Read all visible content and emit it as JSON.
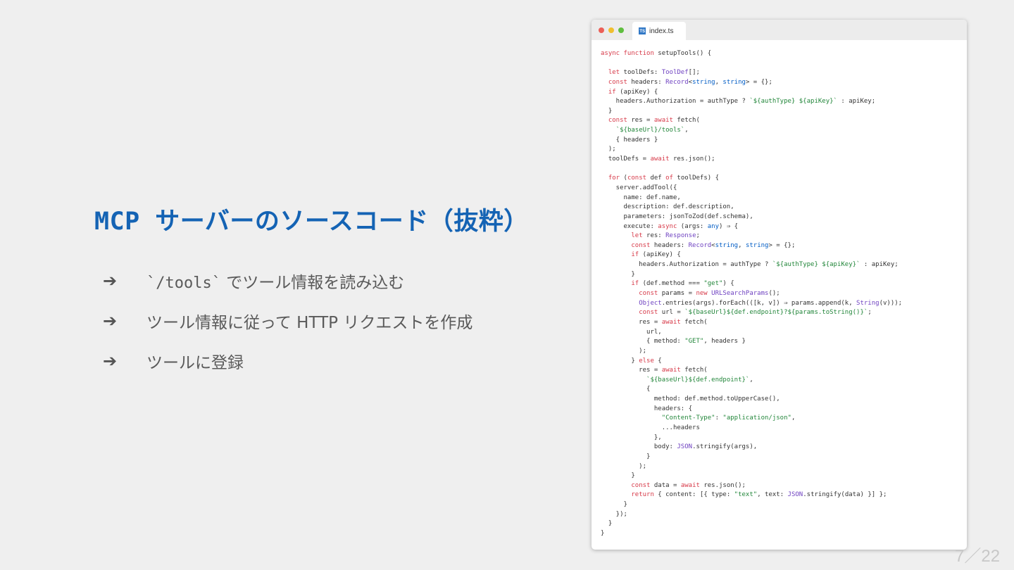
{
  "slide": {
    "title": "MCP サーバーのソースコード（抜粋）",
    "bullets": [
      {
        "arrow": "➔",
        "code": "`/tools`",
        "text": " でツール情報を読み込む"
      },
      {
        "arrow": "➔",
        "code": "",
        "text": "ツール情報に従って HTTP リクエストを作成"
      },
      {
        "arrow": "➔",
        "code": "",
        "text": "ツールに登録"
      }
    ],
    "page_number": "7／22"
  },
  "editor": {
    "tab_name": "index.ts",
    "tab_icon": "typescript-icon",
    "code_lines": [
      "async function setupTools() {",
      "",
      "  let toolDefs: ToolDef[];",
      "  const headers: Record<string, string> = {};",
      "  if (apiKey) {",
      "    headers.Authorization = authType ? `${authType} ${apiKey}` : apiKey;",
      "  }",
      "  const res = await fetch(",
      "    `${baseUrl}/tools`,",
      "    { headers }",
      "  );",
      "  toolDefs = await res.json();",
      "",
      "  for (const def of toolDefs) {",
      "    server.addTool({",
      "      name: def.name,",
      "      description: def.description,",
      "      parameters: jsonToZod(def.schema),",
      "      execute: async (args: any) ⇒ {",
      "        let res: Response;",
      "        const headers: Record<string, string> = {};",
      "        if (apiKey) {",
      "          headers.Authorization = authType ? `${authType} ${apiKey}` : apiKey;",
      "        }",
      "        if (def.method === \"get\") {",
      "          const params = new URLSearchParams();",
      "          Object.entries(args).forEach(([k, v]) ⇒ params.append(k, String(v)));",
      "          const url = `${baseUrl}${def.endpoint}?${params.toString()}`;",
      "          res = await fetch(",
      "            url,",
      "            { method: \"GET\", headers }",
      "          );",
      "        } else {",
      "          res = await fetch(",
      "            `${baseUrl}${def.endpoint}`,",
      "            {",
      "              method: def.method.toUpperCase(),",
      "              headers: {",
      "                \"Content-Type\": \"application/json\",",
      "                ...headers",
      "              },",
      "              body: JSON.stringify(args),",
      "            }",
      "          );",
      "        }",
      "        const data = await res.json();",
      "        return { content: [{ type: \"text\", text: JSON.stringify(data) }] };",
      "      }",
      "    });",
      "  }",
      "}"
    ]
  },
  "colors": {
    "title": "#1463b4",
    "keyword": "#d73a49",
    "function": "#6f42c1",
    "property": "#005cc5",
    "string": "#22863a"
  }
}
